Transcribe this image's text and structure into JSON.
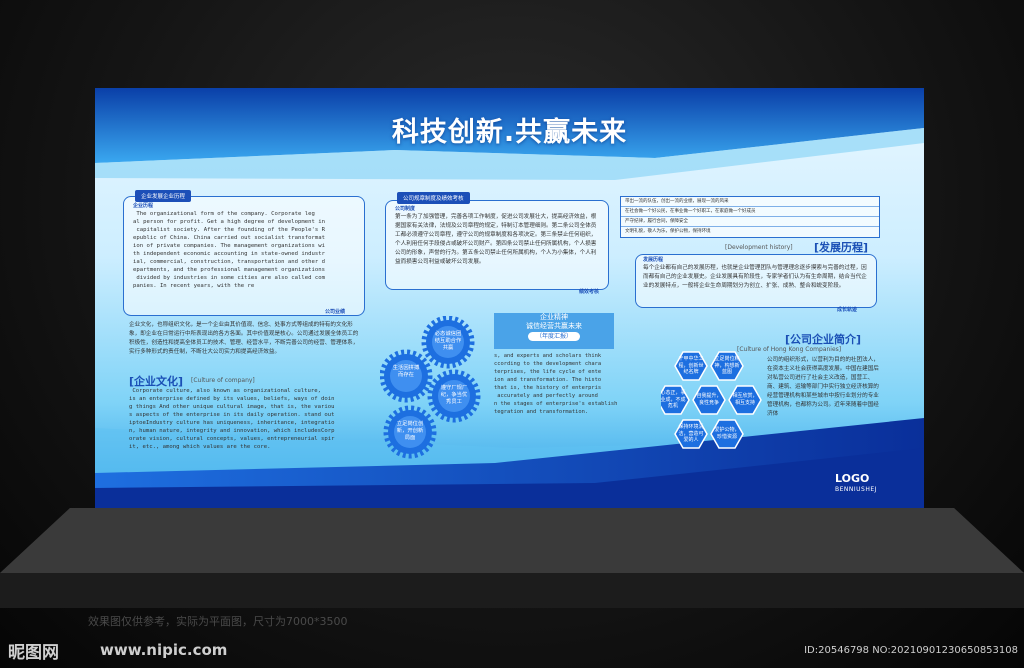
{
  "board": {
    "title": "科技创新.共赢未来",
    "left": {
      "tag": "企业发展企业历程",
      "subtag_top": "企业历程",
      "text": " The organizational form of the company. Corporate leg\nal person for profit. Get a high degree of development in\n capitalist society. After the founding of the People's R\nepublic of China. China carried out socialist transformat\nion of private companies. The management organizations wi\nth independent economic accounting in state-owned industr\nial, commercial, construction, transportation and other d\nepartments, and the professional management organizations\n divided by industries in some cities are also called com\npanies. In recent years, with the re",
      "subtag_bottom": "公司业绩",
      "culture_cn": "企业文化，也称组织文化，是一个企业由其价值观、信念、处事方式等组成的特有的文化形象，即企业在日常运行中所表现出的各方各面。其中价值观是核心。公司通过发展全体员工的积极性，创造性和提高全体员工的技术、管理、经营水平，不断完善公司的经营、管理体系，实行多种形式的责任制，不断壮大公司实力和提高经济效益。",
      "culture_title": "[企业文化]",
      "culture_sub": "[Culture of company]",
      "culture_en": " Corporate culture, also known as organizational culture,\nis an enterprise defined by its values, beliefs, ways of doin\ng things And other unique cultural image, that is, the variou\ns aspects of the enterprise in its daily operation. stand out\niptoeIndustry culture has uniqueness, inheritance, integratio\nn, human nature, integrity and innovation, which includesCorp\norate vision, cultural concepts, values, entrepreneurial spir\nit, etc., among which values are the core."
    },
    "middle": {
      "tag": "公司规章制度及绩效考核",
      "subtag_top": "公司制度",
      "text": "第一条为了加强管理，完善各项工作制度，促进公司发展壮大，提高经济效益，根据国家有关法律，法规及公司章程的规定，特制订本管理细则。第二条公司全体员工都必须遵守公司章程，遵守公司的规章制度和各项决定。第三条禁止任何组织，个人利用任何手段侵占或破坏公司财产。第四条公司禁止任何所属机构，个人损害公司的形象，声誉的行为。第五条公司禁止任何所属机构，个人为小集体，个人利益而损害公司利益或破坏公司发展。",
      "subtag_bottom": "绩效考核",
      "gears": [
        "必态诚信团结互助合作共赢",
        "生活因拼搏而存在",
        "遵守厂规厂纪，争当优秀员工",
        "立足岗位创新，开创新局面"
      ],
      "spirit_title": "企业精神",
      "spirit_line": "诚信经营共赢未来",
      "spirit_pill": "（年度汇报）",
      "spirit_en": "s, and experts and scholars think\nccording to the development chara\nterprises, the life cycle of ente\nion and transformation. The histo\nthat is, the history of enterpris\n accurately and perfectly around\nn the stages of enterprise's establish\ntegration and transformation."
    },
    "right": {
      "dev_rows": [
        "带出一流的队伍，创出一流的业绩，展现一流的风采",
        "在社会做一个好公民，在事业做一个好职工，在家庭做一个好成员",
        "严守纪律，履行合同，保障安全",
        "文明礼貌，敬人为乐，保护公物，保持环境"
      ],
      "dev_en": "[Development history]",
      "dev_cn": "[发展历程]",
      "dev_tag": "发展历程",
      "dev_text": "每个企业都有自己的发展历程，也就是企业管理团队与管理理念逐步摸索与完善的过程，因而都有自己的企业发展史。企业发展具有阶段性，专家学者们认为有生命周期，结合当代企业的发展特点，一般将企业生命周期划分为创立、扩张、成熟、整合和蜕变阶段。",
      "dev_tag_bottom": "成长轨迹",
      "intro_cn": "[公司企业简介]",
      "intro_en": "[Culture of Hong Kong Companies]",
      "intro_text": "公司的组织形式，以营利为目的的社团法人，在资本主义社会获得高度发展。中国在建国后对私营公司进行了社会主义改造，国营工、商、建筑、运输等部门中实行独立经济核算的经营管理机构和某些城市中按行业划分的专业管理机构，也都称为公司。近年来随着中国经济体",
      "hexes": [
        "干甲中华工程，创新世纪名牌",
        "立足岗位精神，构想新蓝图",
        "心态正，事业成，不成危机",
        "自我提升，良性竞争",
        "相互欣赏，相互支持",
        "保持环境清洁，营造可爱的人",
        "爱护公物，珍惜资源"
      ],
      "logo": "LOGO",
      "logo_sub": "BENNIUSHEJ"
    }
  },
  "caption": "效果图仅供参考，实际为平面图，尺寸为7000*3500",
  "watermark": {
    "brand": "昵图网",
    "url": "www.nipic.com",
    "id": "ID:20546798 NO:20210901230650853108"
  },
  "colors": {
    "accent": "#1c4fb8",
    "board_light": "#e9f7ff",
    "board_dark": "#0a3fa8"
  }
}
